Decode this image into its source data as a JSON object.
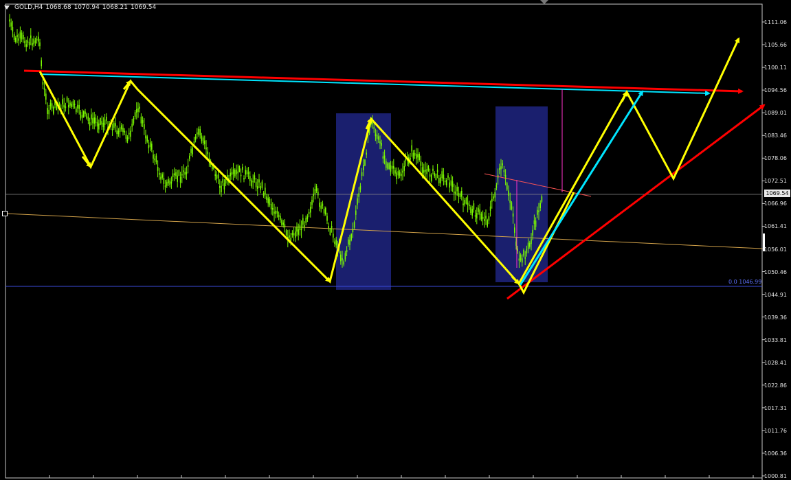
{
  "header": {
    "symbol": "GOLD,H4",
    "open": "1068.68",
    "high": "1070.94",
    "low": "1068.21",
    "close": "1069.54"
  },
  "price_axis": {
    "ticks": [
      "1111.06",
      "1105.66",
      "1100.11",
      "1094.56",
      "1089.01",
      "1083.46",
      "1078.06",
      "1072.51",
      "1066.96",
      "1061.41",
      "1056.01",
      "1050.46",
      "1044.91",
      "1039.36",
      "1033.81",
      "1028.41",
      "1022.86",
      "1017.31",
      "1011.76",
      "1006.36",
      "1000.81"
    ],
    "current_price": "1069.54"
  },
  "fib_label": "0.0 1046.99",
  "colors": {
    "background": "#000000",
    "candles": "#7cfc00",
    "zigzag": "#ffff00",
    "trend_red": "#ff0000",
    "trend_cyan": "#00e5ff",
    "box": "#1a1f6e",
    "fib_line": "#3b4bdb",
    "orange_line": "#d2a24a",
    "magenta": "#ff33cc"
  },
  "icons": {
    "menu": "down-triangle-icon",
    "scroll": "shift-tab-icon"
  }
}
